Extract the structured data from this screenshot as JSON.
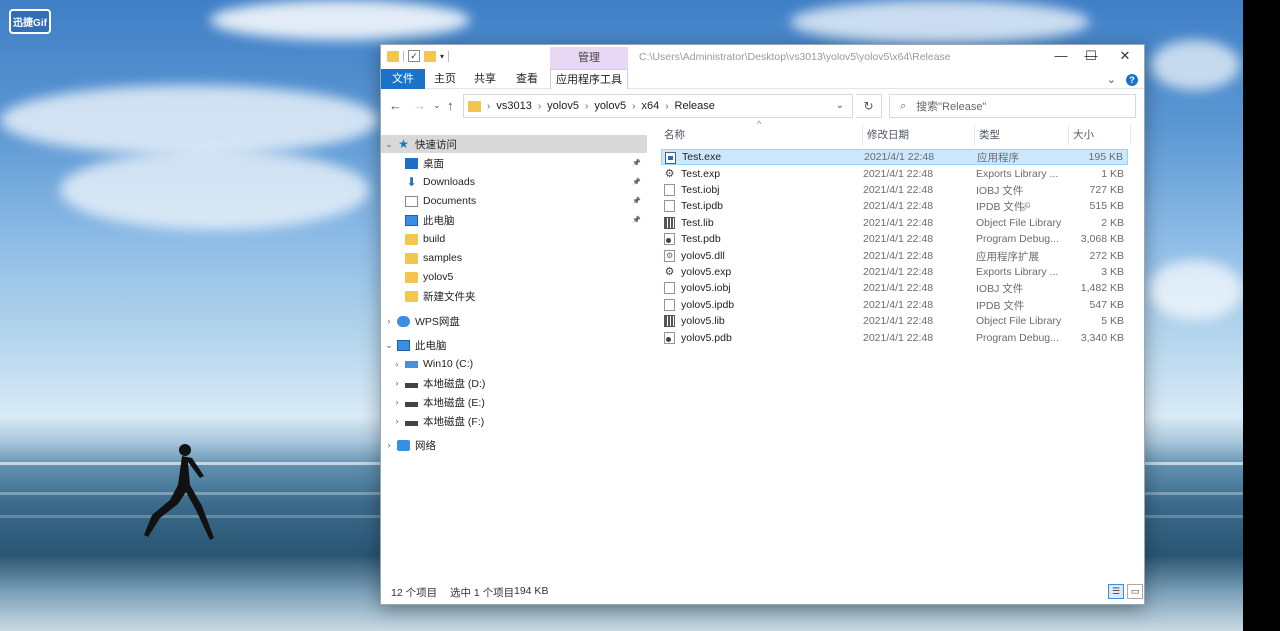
{
  "watermark": "迅捷Gif",
  "window": {
    "title_path": "C:\\Users\\Administrator\\Desktop\\vs3013\\yolov5\\yolov5\\x64\\Release",
    "manage_tab": "管理",
    "controls": {
      "minimize": "—",
      "maximize": "☐",
      "close": "✕"
    }
  },
  "ribbon": {
    "tabs": [
      "文件",
      "主页",
      "共享",
      "查看",
      "应用程序工具"
    ],
    "expand": "⌄",
    "help": "?"
  },
  "address": {
    "breadcrumbs": [
      "vs3013",
      "yolov5",
      "yolov5",
      "x64",
      "Release"
    ],
    "separator": "›",
    "search_placeholder": "搜索\"Release\"",
    "back": "←",
    "forward": "→",
    "recent": "⌄",
    "up": "↑",
    "refresh": "↻",
    "dropdown": "⌄"
  },
  "nav": {
    "items": [
      {
        "label": "快速访问",
        "icon": "star-icon",
        "arrow": "⌄",
        "selected": true
      },
      {
        "label": "桌面",
        "icon": "desktop-icon",
        "pinned": true
      },
      {
        "label": "Downloads",
        "icon": "download-icon",
        "pinned": true
      },
      {
        "label": "Documents",
        "icon": "documents-icon",
        "pinned": true
      },
      {
        "label": "此电脑",
        "icon": "pc-icon",
        "pinned": true
      },
      {
        "label": "build",
        "icon": "folder-icon"
      },
      {
        "label": "samples",
        "icon": "folder-icon"
      },
      {
        "label": "yolov5",
        "icon": "folder-icon"
      },
      {
        "label": "新建文件夹",
        "icon": "folder-icon"
      },
      {
        "label": "WPS网盘",
        "icon": "cloud-icon",
        "arrow": "›"
      },
      {
        "label": "此电脑",
        "icon": "pc-icon",
        "arrow": "⌄"
      },
      {
        "label": "Win10 (C:)",
        "icon": "windows-drive-icon",
        "arrow": "›"
      },
      {
        "label": "本地磁盘 (D:)",
        "icon": "drive-icon",
        "arrow": "›"
      },
      {
        "label": "本地磁盘 (E:)",
        "icon": "drive-icon",
        "arrow": "›"
      },
      {
        "label": "本地磁盘 (F:)",
        "icon": "drive-icon",
        "arrow": "›"
      },
      {
        "label": "网络",
        "icon": "network-icon",
        "arrow": "›"
      }
    ],
    "pin_glyph": "📌"
  },
  "columns": {
    "name": "名称",
    "date": "修改日期",
    "type": "类型",
    "size": "大小"
  },
  "files": [
    {
      "name": "Test.exe",
      "date": "2021/4/1 22:48",
      "type": "应用程序",
      "size": "195 KB",
      "icon": "exe-icon",
      "selected": true
    },
    {
      "name": "Test.exp",
      "date": "2021/4/1 22:48",
      "type": "Exports Library ...",
      "size": "1 KB",
      "icon": "gear-file-icon"
    },
    {
      "name": "Test.iobj",
      "date": "2021/4/1 22:48",
      "type": "IOBJ 文件",
      "size": "727 KB",
      "icon": "blank-file-icon"
    },
    {
      "name": "Test.ipdb",
      "date": "2021/4/1 22:48",
      "type": "IPDB 文件",
      "size": "515 KB",
      "icon": "blank-file-icon"
    },
    {
      "name": "Test.lib",
      "date": "2021/4/1 22:48",
      "type": "Object File Library",
      "size": "2 KB",
      "icon": "lib-file-icon"
    },
    {
      "name": "Test.pdb",
      "date": "2021/4/1 22:48",
      "type": "Program Debug...",
      "size": "3,068 KB",
      "icon": "pdb-file-icon"
    },
    {
      "name": "yolov5.dll",
      "date": "2021/4/1 22:48",
      "type": "应用程序扩展",
      "size": "272 KB",
      "icon": "dll-file-icon"
    },
    {
      "name": "yolov5.exp",
      "date": "2021/4/1 22:48",
      "type": "Exports Library ...",
      "size": "3 KB",
      "icon": "gear-file-icon"
    },
    {
      "name": "yolov5.iobj",
      "date": "2021/4/1 22:48",
      "type": "IOBJ 文件",
      "size": "1,482 KB",
      "icon": "blank-file-icon"
    },
    {
      "name": "yolov5.ipdb",
      "date": "2021/4/1 22:48",
      "type": "IPDB 文件",
      "size": "547 KB",
      "icon": "blank-file-icon"
    },
    {
      "name": "yolov5.lib",
      "date": "2021/4/1 22:48",
      "type": "Object File Library",
      "size": "5 KB",
      "icon": "lib-file-icon"
    },
    {
      "name": "yolov5.pdb",
      "date": "2021/4/1 22:48",
      "type": "Program Debug...",
      "size": "3,340 KB",
      "icon": "pdb-file-icon"
    }
  ],
  "status": {
    "count": "12 个项目",
    "selected": "选中 1 个项目",
    "size": "194 KB",
    "view_details": "☰",
    "view_tiles": "▭"
  }
}
